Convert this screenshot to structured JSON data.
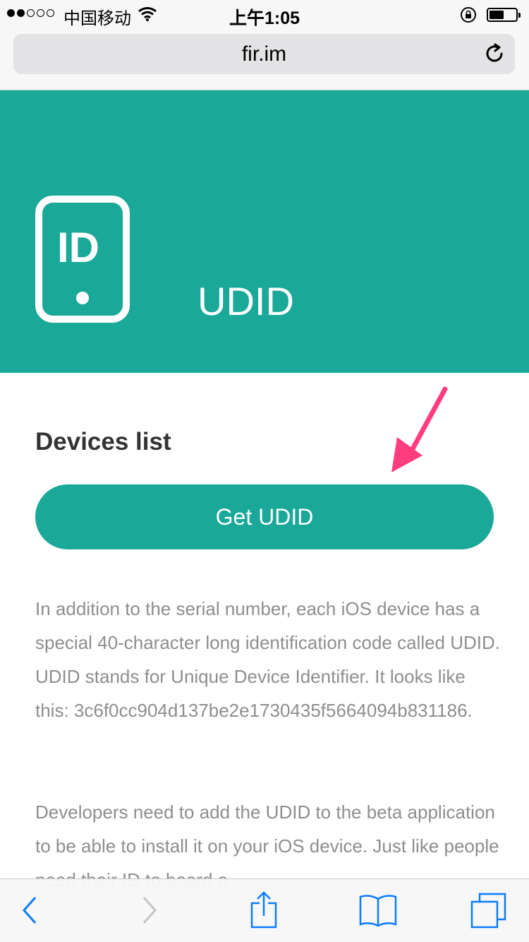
{
  "status_bar": {
    "carrier": "中国移动",
    "time": "上午1:05",
    "signal_bars_filled": 2,
    "signal_bars_total": 5
  },
  "address_bar": {
    "url": "fir.im"
  },
  "hero": {
    "icon_label": "ID",
    "title": "UDID"
  },
  "content": {
    "heading": "Devices list",
    "button_label": "Get UDID",
    "paragraph1": "In addition to the serial number, each iOS device has a special 40-character long identification code called UDID. UDID stands for Unique Device Identifier. It looks like this: 3c6f0cc904d137be2e1730435f5664094b831186.",
    "paragraph2": "Developers need to add the UDID to the beta application to be able to install it on your iOS device. Just like people need their ID to board a"
  },
  "colors": {
    "accent": "#1aa898",
    "ios_blue": "#0a7cff",
    "arrow": "#ff3d7f",
    "text_muted": "#8e8e8e"
  },
  "icons": [
    "wifi-icon",
    "rotation-lock-icon",
    "battery-icon",
    "reload-icon",
    "id-card-icon",
    "back-icon",
    "forward-icon",
    "share-icon",
    "bookmarks-icon",
    "tabs-icon"
  ]
}
